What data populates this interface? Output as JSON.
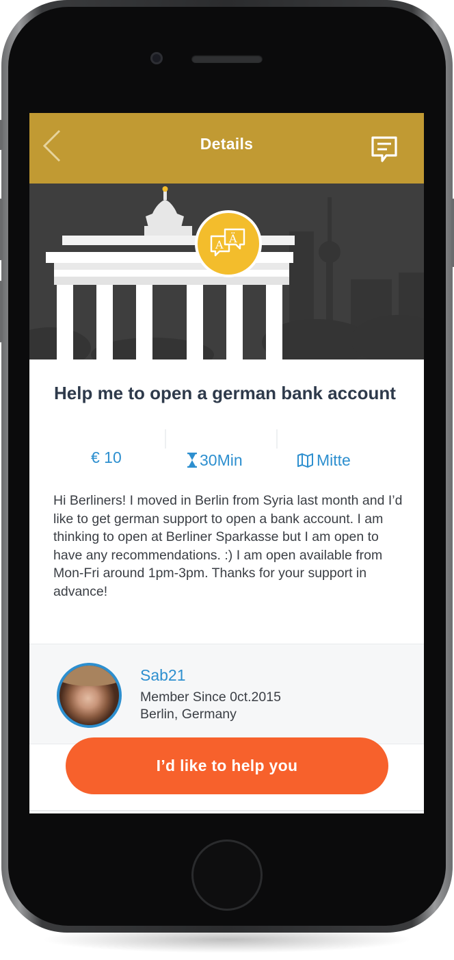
{
  "header": {
    "title": "Details",
    "back_icon": "chevron-left-icon",
    "chat_icon": "message-icon",
    "color": "#c19a33"
  },
  "hero": {
    "background_color": "#3e3e3e",
    "badge_icon": "translate-icon",
    "badge_color": "#f3bd2c"
  },
  "request": {
    "title": "Help me to open a german bank account",
    "price": "€ 10",
    "duration": "30Min",
    "duration_icon": "hourglass-icon",
    "district": "Mitte",
    "district_icon": "map-icon",
    "description": "Hi Berliners! I moved in Berlin from Syria last month and I’d like to get german support to open a bank account. I am thinking to open at Berliner Sparkasse but I am open to have any recommendations. :) I am open available from Mon-Fri around 1pm-3pm. Thanks for your support in advance!"
  },
  "user": {
    "name": "Sab21",
    "member_since": "Member Since 0ct.2015",
    "location": "Berlin, Germany"
  },
  "action": {
    "help_label": "I’d like to help you",
    "color": "#f7612c"
  },
  "accent_color": "#2d8fcf"
}
